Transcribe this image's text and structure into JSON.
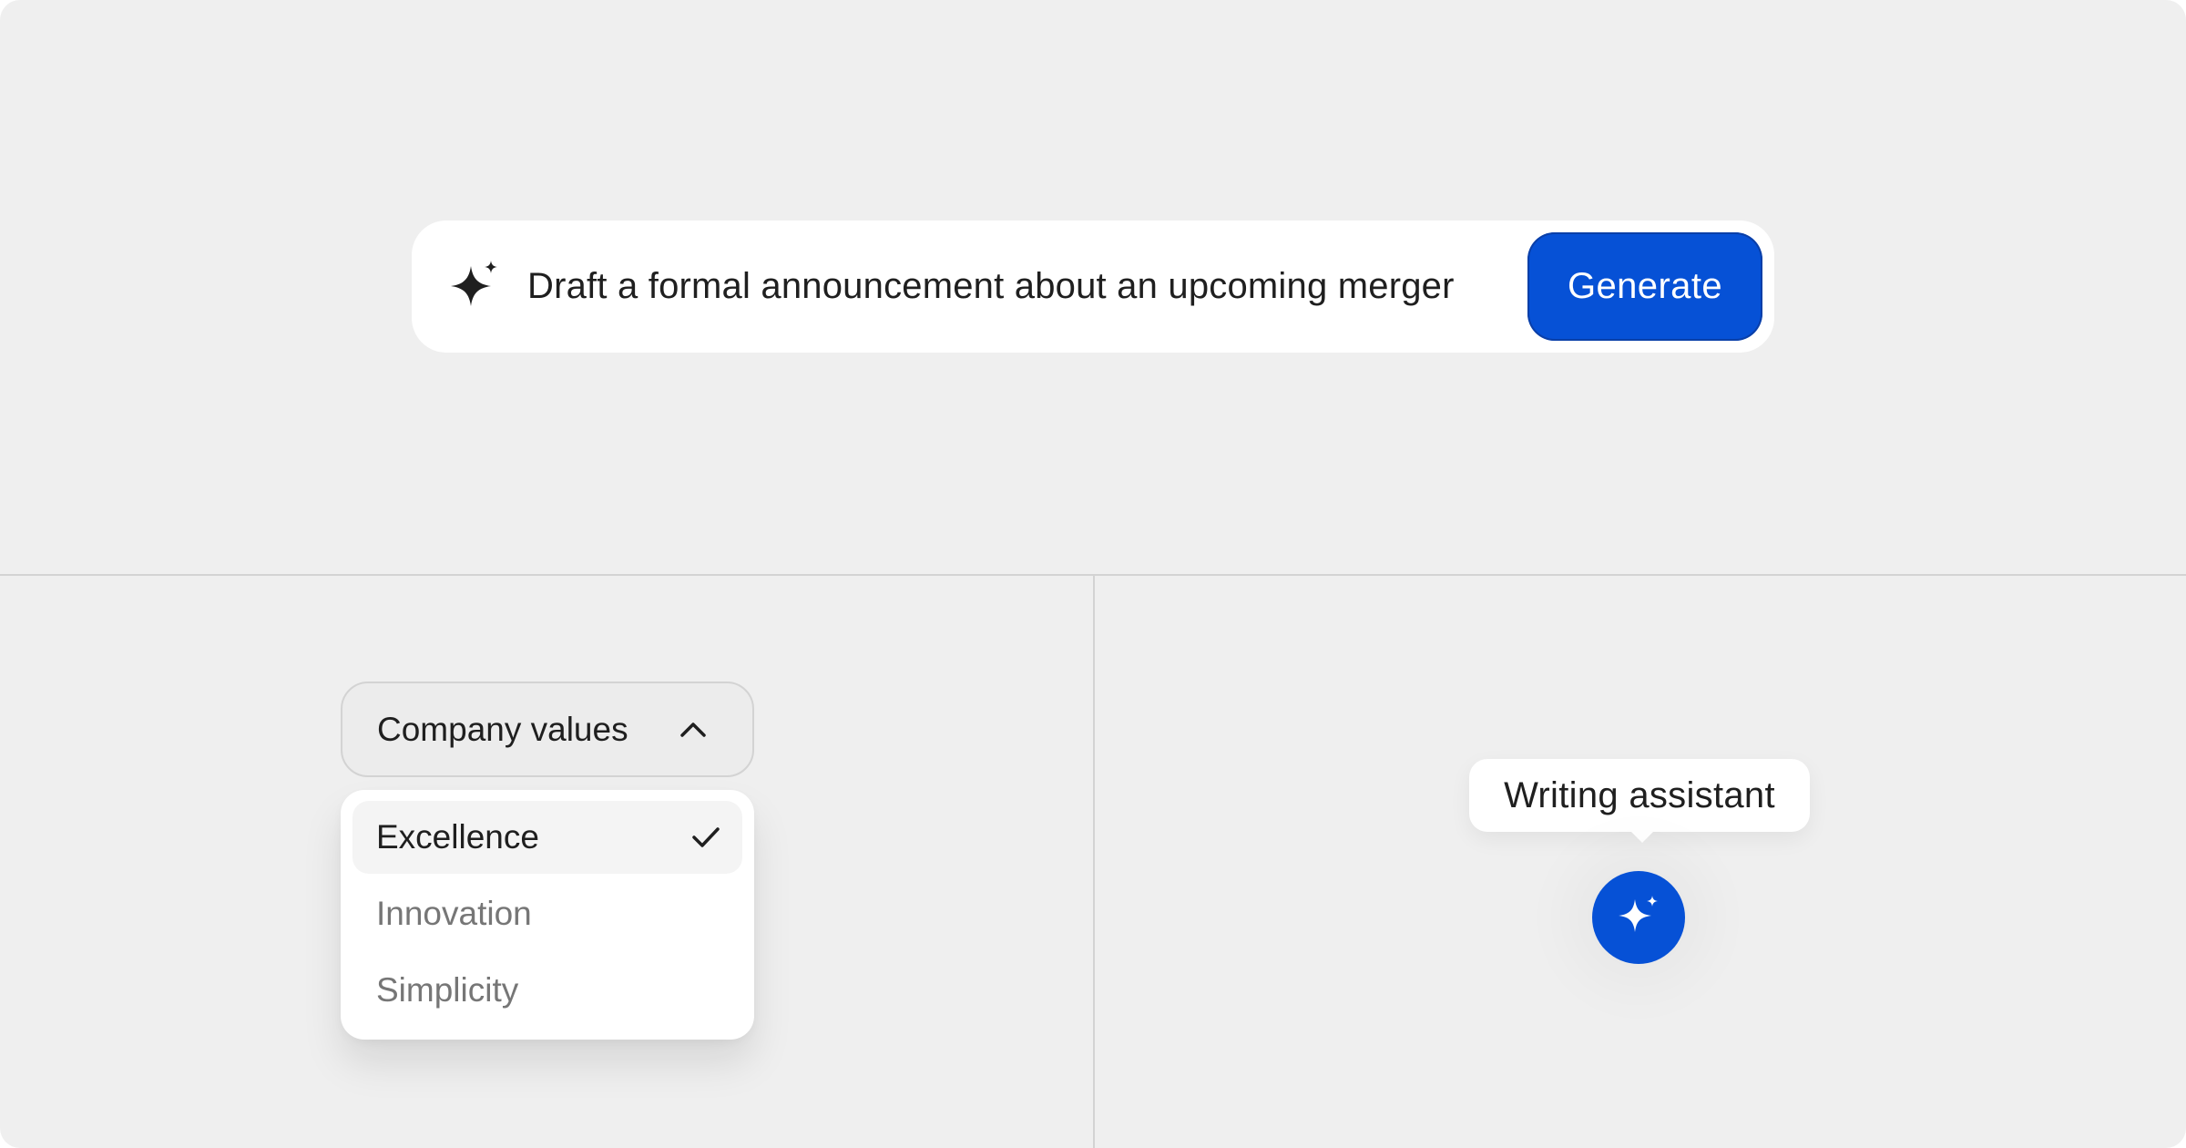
{
  "prompt": {
    "icon": "sparkle-icon",
    "text": "Draft a formal announcement about an upcoming merger",
    "generate_label": "Generate"
  },
  "dropdown": {
    "label": "Company values",
    "expanded": true,
    "chevron_icon": "chevron-up-icon",
    "items": [
      {
        "label": "Excellence",
        "selected": true,
        "icon": "check-icon"
      },
      {
        "label": "Innovation",
        "selected": false
      },
      {
        "label": "Simplicity",
        "selected": false
      }
    ]
  },
  "assistant": {
    "tooltip": "Writing assistant",
    "icon": "sparkle-icon"
  },
  "colors": {
    "background": "#efefef",
    "surface": "#ffffff",
    "accent": "#0651d6",
    "text": "#1f1f1f",
    "muted_text": "#767676",
    "divider": "#d3d3d3"
  }
}
